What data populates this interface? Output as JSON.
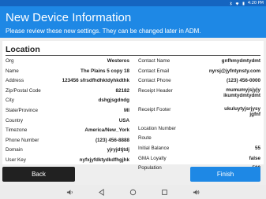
{
  "status_bar": {
    "time": "4:20 PM"
  },
  "header": {
    "title": "New Device Information",
    "subtitle": "Please review these new settings. They can be changed later in ADM."
  },
  "section": {
    "heading": "Location",
    "left_fields": [
      {
        "label": "Org",
        "value": "Westeros"
      },
      {
        "label": "Name",
        "value": "The Plains 5 copy 18"
      },
      {
        "label": "Address",
        "value": "123456 sfrsdfhdhktdyhkdthk"
      },
      {
        "label": "Zip/Postal Code",
        "value": "82182"
      },
      {
        "label": "City",
        "value": "dshgjsgdndg"
      },
      {
        "label": "State/Province",
        "value": "MI"
      },
      {
        "label": "Country",
        "value": "USA"
      },
      {
        "label": "Timezone",
        "value": "America/New_York"
      },
      {
        "label": "Phone Number",
        "value": "(123) 456-8888"
      },
      {
        "label": "Domain",
        "value": "yjryjdtjtdj"
      },
      {
        "label": "User Key",
        "value": "nyfxjyfdktydkdfhgjhk"
      }
    ],
    "right_fields": [
      {
        "label": "Contact Name",
        "value": "gnfhmydmtydmt"
      },
      {
        "label": "Contact Email",
        "value": "nyrsj@jyfntynsty.com"
      },
      {
        "label": "Contact Phone",
        "value": "(123) 456-0000"
      },
      {
        "label": "Receipt Header",
        "value": "mumumyjsjyjy ikumtydmtydmt"
      },
      {
        "label": "Receipt Footer",
        "value": "ukuluytyjsrjysy jgfnf"
      },
      {
        "label": "Location Number",
        "value": ""
      },
      {
        "label": "Route",
        "value": ""
      },
      {
        "label": "Initial Balance",
        "value": "55"
      },
      {
        "label": "GMA Loyalty",
        "value": "false"
      },
      {
        "label": "Population",
        "value": "500"
      }
    ]
  },
  "buttons": {
    "back": "Back",
    "finish": "Finish"
  },
  "colors": {
    "accent": "#1e88e5",
    "status_bar": "#1565c0",
    "back_button": "#212121"
  }
}
